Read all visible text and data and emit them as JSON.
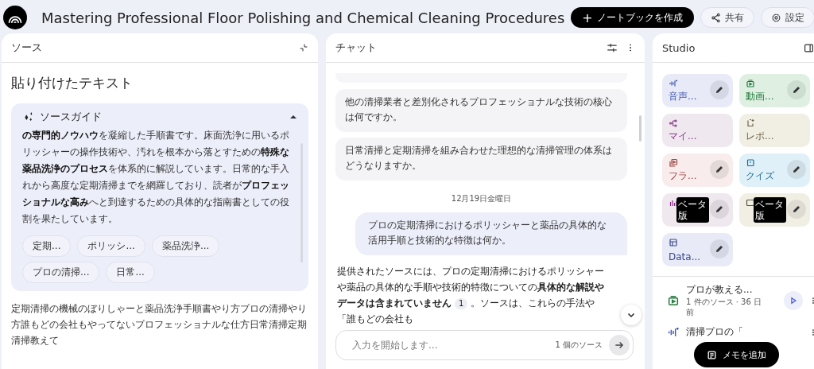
{
  "header": {
    "title": "Mastering Professional Floor Polishing and Chemical Cleaning Procedures",
    "create_button": "ノートブックを作成",
    "create_icon": "+",
    "share_button": "共有",
    "settings_button": "設定"
  },
  "sources": {
    "title": "ソース",
    "source_title": "貼り付けたテキスト",
    "guide": {
      "title": "ソースガイド",
      "expanded": true,
      "summary": "**の専門的ノウハウ**を凝縮した手順書です。床面洗浄に用いるポリッシャーの操作技術や、汚れを根本から落とすための**特殊な薬品洗浄のプロセス**を体系的に解説しています。日常的な手入れから高度な定期清掃までを網羅しており、読者が**プロフェッショナルな高み**へと到達するための具体的な指南書としての役割を果たしています。",
      "topics": [
        "定期...",
        "ポリッシ...",
        "薬品洗浄...",
        "プロの清掃...",
        "日常..."
      ]
    },
    "body": "定期清掃の機械のぼりしゃーと薬品洗浄手順書やり方プロの清掃やり方誰もどの会社もやってないプロフェッショナルな仕方日常清掃定期清掃教えて"
  },
  "chat": {
    "title": "チャット",
    "suggestions": [
      "他の清掃業者と差別化されるプロフェッショナルな技術の核心は何ですか。",
      "日常清掃と定期清掃を組み合わせた理想的な清掃管理の体系はどうなりますか。"
    ],
    "date": "12月19日金曜日",
    "user_message": "プロの定期清掃におけるポリッシャーと薬品の具体的な活用手順と技術的な特徴は何か。",
    "response": {
      "before": "提供されたソースには、プロの定期清掃におけるポリッシャーや薬品の具体的な手順や技術的特徴についての**具体的な解説やデータは含まれていません**",
      "citation": "1",
      "after": "。ソースは、これらの手法や「誰もどの会社も"
    },
    "input": {
      "placeholder": "入力を開始します...",
      "source_count": "1 個のソース"
    }
  },
  "studio": {
    "title": "Studio",
    "tiles": [
      {
        "kind": "audio",
        "label": "音声...",
        "color": "#e8eaf8",
        "editable": true
      },
      {
        "kind": "video",
        "label": "動画...",
        "color": "#dff0e2",
        "editable": true
      },
      {
        "kind": "mindmap",
        "label": "マイ...",
        "color": "#efe8ef",
        "editable": false
      },
      {
        "kind": "report",
        "label": "レポ...",
        "color": "#f1efe4",
        "editable": false
      },
      {
        "kind": "flashcards",
        "label": "フラ...",
        "color": "#f8ecec",
        "editable": true
      },
      {
        "kind": "quiz",
        "label": "クイズ",
        "color": "#e0f0f8",
        "editable": true
      },
      {
        "kind": "infographic",
        "badge": "ベータ版",
        "color": "#efe8ef",
        "editable": true
      },
      {
        "kind": "slides",
        "badge": "ベータ版",
        "color": "#f1efe4",
        "editable": true
      },
      {
        "kind": "table",
        "label": "Data...",
        "color": "#e8eaf8",
        "editable": true
      }
    ],
    "outputs": [
      {
        "kind": "video",
        "title": "プロが教える...",
        "meta": "1 件のソース · 36 日前",
        "playable": true
      },
      {
        "kind": "audio",
        "title": "清掃プロの「",
        "playable": false
      }
    ],
    "add_note": "メモを追加"
  }
}
